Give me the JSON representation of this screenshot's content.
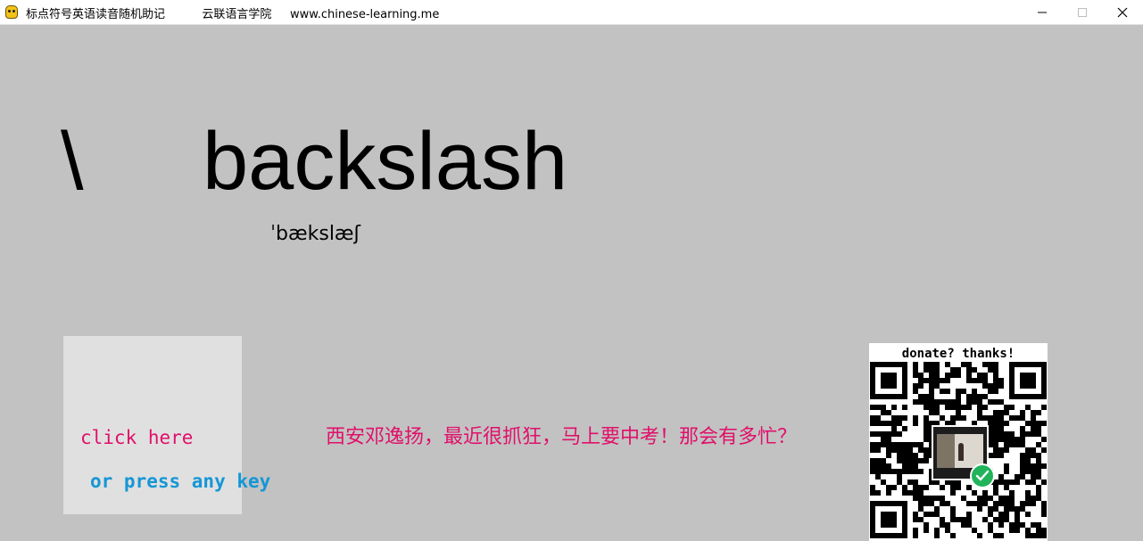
{
  "window": {
    "title": "标点符号英语读音随机助记          云联语言学院     www.chinese-learning.me"
  },
  "card": {
    "symbol": "\\",
    "word": "backslash",
    "ipa": "ˈbækslæʃ"
  },
  "controls": {
    "click_label": "click here",
    "press_label": "or press any key"
  },
  "message": "西安邓逸扬，最近很抓狂，马上要中考！那会有多忙？",
  "donate": {
    "label": "donate? thanks!"
  },
  "colors": {
    "background": "#c2c2c2",
    "panel": "#e0e0e0",
    "accent_pink": "#e0106a",
    "accent_blue": "#1596d6"
  }
}
